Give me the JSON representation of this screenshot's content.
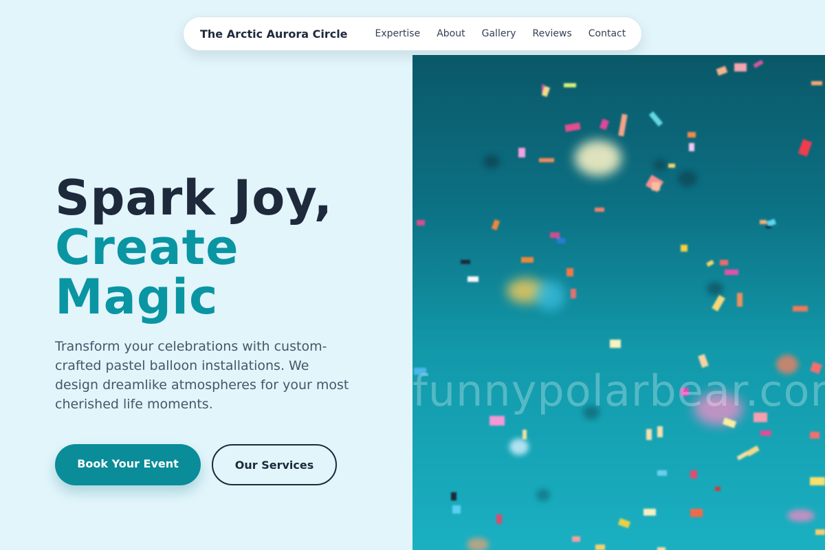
{
  "nav": {
    "brand": "The Arctic Aurora Circle",
    "links": [
      "Expertise",
      "About",
      "Gallery",
      "Reviews",
      "Contact"
    ]
  },
  "hero": {
    "headline_line1": "Spark Joy,",
    "headline_line2": "Create",
    "headline_line3": "Magic",
    "description": "Transform your celebrations with custom-crafted pastel balloon installations. We design dreamlike atmospheres for your most cherished life moments.",
    "primary_cta": "Book Your Event",
    "secondary_cta": "Our Services"
  },
  "image": {
    "watermark": "funnypolarbear.com"
  },
  "colors": {
    "background": "#e2f5fb",
    "accent": "#0a8c99",
    "headline_dark": "#1e293b",
    "headline_accent": "#0a95a3"
  }
}
